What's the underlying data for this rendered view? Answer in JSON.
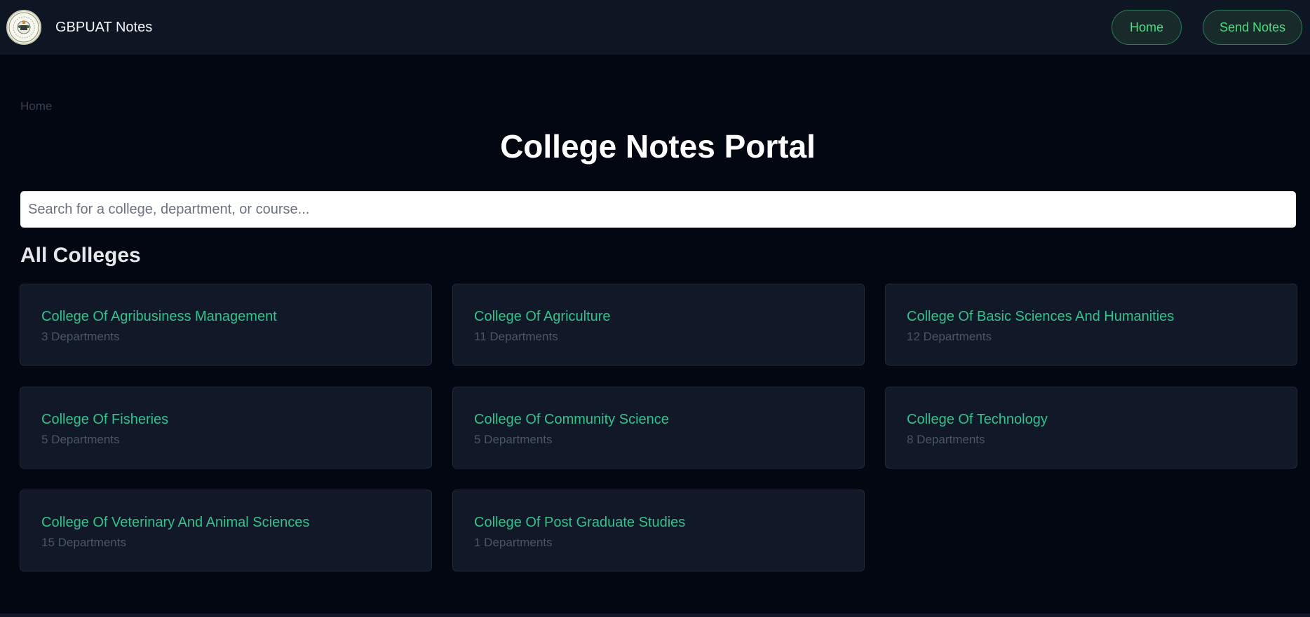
{
  "navbar": {
    "logo_icon": "university-seal-logo",
    "brand": "GBPUAT Notes",
    "buttons": {
      "home": "Home",
      "send_notes": "Send Notes"
    }
  },
  "breadcrumb": "Home",
  "page_title": "College Notes Portal",
  "search": {
    "placeholder": "Search for a college, department, or course..."
  },
  "section_title": "All Colleges",
  "colleges": [
    {
      "name": "College Of Agribusiness Management",
      "count": "3 Departments"
    },
    {
      "name": "College Of Agriculture",
      "count": "11 Departments"
    },
    {
      "name": "College Of Basic Sciences And Humanities",
      "count": "12 Departments"
    },
    {
      "name": "College Of Fisheries",
      "count": "5 Departments"
    },
    {
      "name": "College Of Community Science",
      "count": "5 Departments"
    },
    {
      "name": "College Of Technology",
      "count": "8 Departments"
    },
    {
      "name": "College Of Veterinary And Animal Sciences",
      "count": "15 Departments"
    },
    {
      "name": "College Of Post Graduate Studies",
      "count": "1 Departments"
    }
  ],
  "colors": {
    "background": "#030712",
    "navbar": "#0f1623",
    "card": "#111827",
    "accent_green": "#34c28b",
    "button_text": "#4ade80"
  }
}
